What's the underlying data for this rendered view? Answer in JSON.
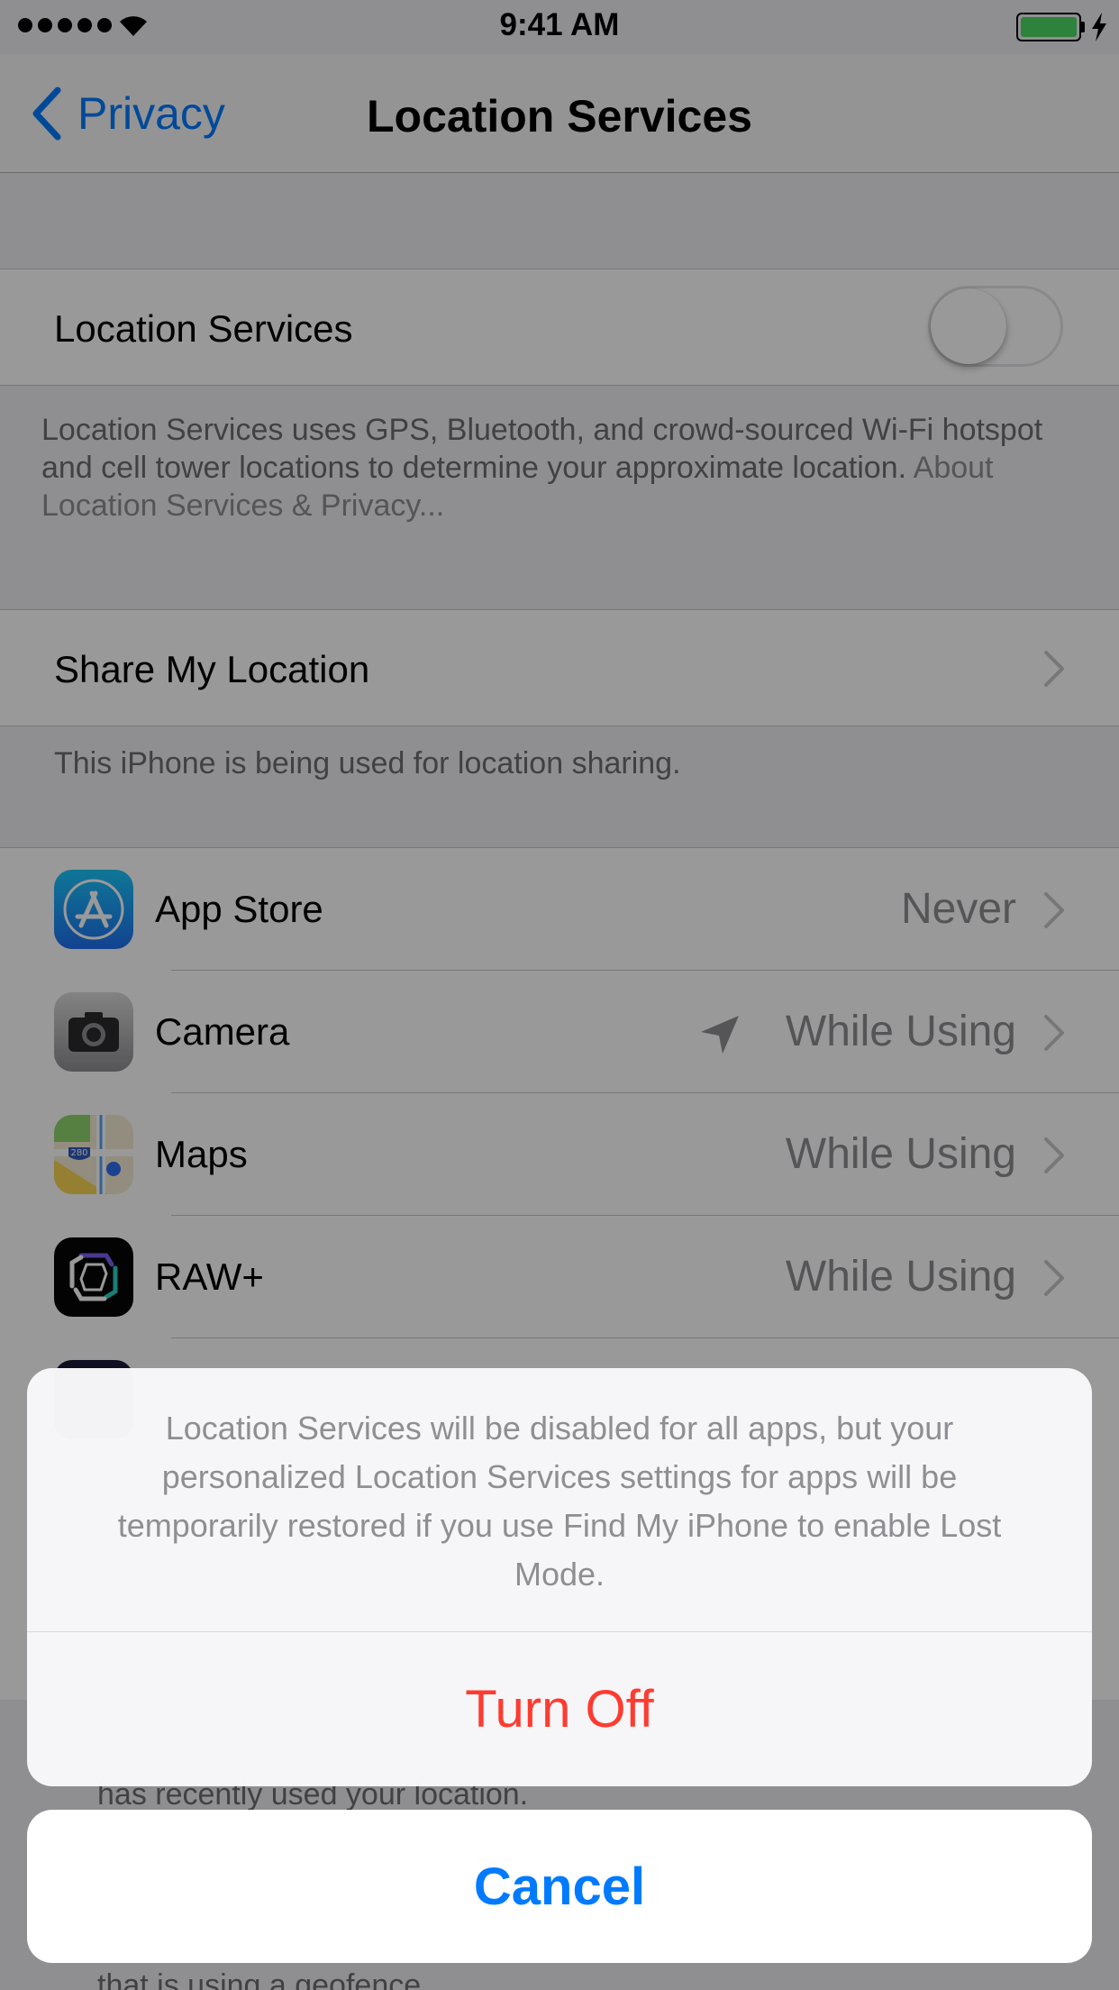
{
  "status_bar": {
    "time": "9:41 AM",
    "signal_bars": 5,
    "battery_color": "#4cd964"
  },
  "nav": {
    "back_label": "Privacy",
    "title": "Location Services"
  },
  "location_services": {
    "label": "Location Services",
    "toggle_on": false,
    "description": "Location Services uses GPS, Bluetooth, and crowd-sourced Wi-Fi hotspot and cell tower locations to determine your approximate location. ",
    "link": "About Location Services & Privacy..."
  },
  "share": {
    "label": "Share My Location",
    "footer": "This iPhone is being used for location sharing."
  },
  "apps": [
    {
      "name": "App Store",
      "value": "Never",
      "icon": "app-store-icon"
    },
    {
      "name": "Camera",
      "value": "While Using",
      "icon": "camera-icon",
      "recent_use": true
    },
    {
      "name": "Maps",
      "value": "While Using",
      "icon": "maps-icon",
      "badge": "280"
    },
    {
      "name": "RAW+",
      "value": "While Using",
      "icon": "raw-plus-icon"
    }
  ],
  "partial_footer": {
    "line1": "has recently used your location.",
    "line2": "that is using a geofence."
  },
  "sheet": {
    "message": "Location Services will be disabled for all apps, but your personalized Location Services settings for apps will be temporarily restored if you use Find My iPhone to enable Lost Mode.",
    "destructive_label": "Turn Off",
    "cancel_label": "Cancel"
  },
  "colors": {
    "accent": "#007aff",
    "destructive": "#ff3b30",
    "secondary_text": "#8e8e93"
  }
}
